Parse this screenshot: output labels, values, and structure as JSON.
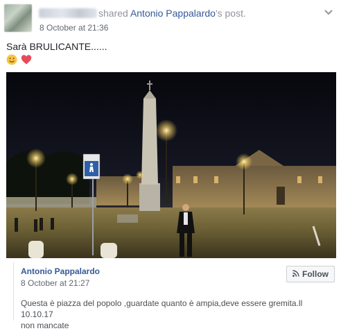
{
  "header": {
    "action_text": "shared ",
    "author": "Antonio Pappalardo",
    "suffix": "'s post.",
    "timestamp": "8 October at 21:36",
    "menu_icon": "chevron-down-icon"
  },
  "post": {
    "text": "Sarà BRULICANTE......",
    "emojis": [
      "smile-emoji-icon",
      "heart-emoji-icon"
    ]
  },
  "shared_card": {
    "author": "Antonio Pappalardo",
    "timestamp": "8 October at 21:27",
    "follow_label": "Follow",
    "follow_icon": "rss-icon",
    "body_line1": "Questa è piazza del popolo ,guardate quanto è ampia,deve essere gremita.ll 10.10.17",
    "body_line2": "non mancate"
  },
  "colors": {
    "link": "#365899",
    "meta": "#90949c",
    "heart": "#e8495a",
    "smile": "#f6c544"
  }
}
